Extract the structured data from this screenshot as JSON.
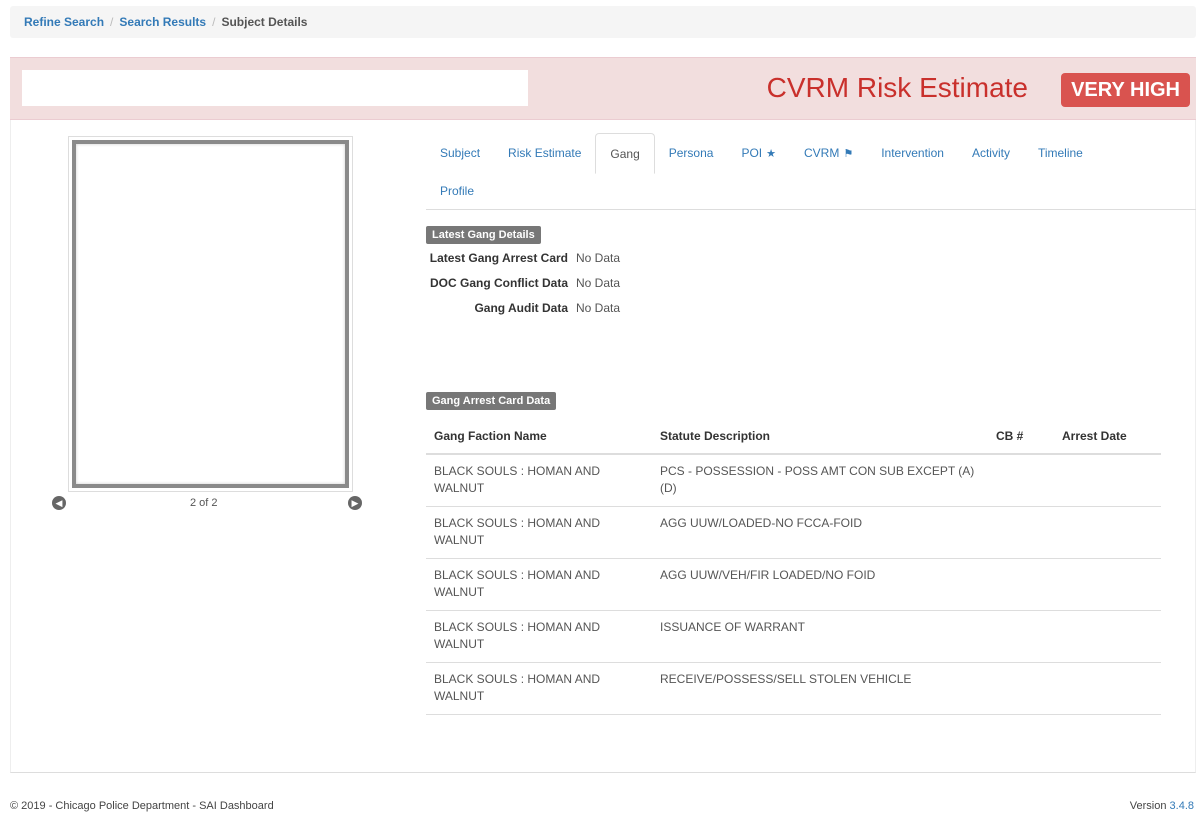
{
  "breadcrumb": {
    "items": [
      "Refine Search",
      "Search Results"
    ],
    "current": "Subject Details",
    "separator": "/"
  },
  "banner": {
    "risk_label": "CVRM Risk Estimate",
    "risk_level": "VERY HIGH"
  },
  "photo": {
    "count": "2 of 2"
  },
  "tabs": {
    "row1": [
      "Subject",
      "Risk Estimate",
      "Gang",
      "Persona",
      "POI",
      "CVRM",
      "Intervention",
      "Activity",
      "Timeline"
    ],
    "row2": [
      "Profile"
    ],
    "active": "Gang"
  },
  "latest_gang_details": {
    "header": "Latest Gang Details",
    "rows": [
      {
        "key": "Latest Gang Arrest Card",
        "value": "No Data"
      },
      {
        "key": "DOC Gang Conflict Data",
        "value": "No Data"
      },
      {
        "key": "Gang Audit Data",
        "value": "No Data"
      }
    ]
  },
  "gang_arrest_card": {
    "header": "Gang Arrest Card Data",
    "columns": [
      "Gang Faction Name",
      "Statute Description",
      "CB #",
      "Arrest Date"
    ],
    "rows": [
      {
        "faction": "BLACK SOULS : HOMAN AND WALNUT",
        "statute": "PCS - POSSESSION - POSS AMT CON SUB EXCEPT (A)(D)",
        "cb": "",
        "date": ""
      },
      {
        "faction": "BLACK SOULS : HOMAN AND WALNUT",
        "statute": "AGG UUW/LOADED-NO FCCA-FOID",
        "cb": "",
        "date": ""
      },
      {
        "faction": "BLACK SOULS : HOMAN AND WALNUT",
        "statute": "AGG UUW/VEH/FIR LOADED/NO FOID",
        "cb": "",
        "date": ""
      },
      {
        "faction": "BLACK SOULS : HOMAN AND WALNUT",
        "statute": "ISSUANCE OF WARRANT",
        "cb": "",
        "date": ""
      },
      {
        "faction": "BLACK SOULS : HOMAN AND WALNUT",
        "statute": "RECEIVE/POSSESS/SELL STOLEN VEHICLE",
        "cb": "",
        "date": ""
      }
    ]
  },
  "footer": {
    "copyright": "© 2019 - Chicago Police Department - SAI Dashboard",
    "version_label": "Version",
    "version_number": "3.4.8"
  },
  "icons": {
    "poi": "star-icon",
    "cvrm": "flag-icon",
    "prev": "chevron-left-icon",
    "next": "chevron-right-icon"
  },
  "colors": {
    "link": "#337ab7",
    "danger": "#d9534f",
    "danger_text": "#c9302c",
    "banner_bg": "#f2dede",
    "label_bg": "#777777"
  }
}
